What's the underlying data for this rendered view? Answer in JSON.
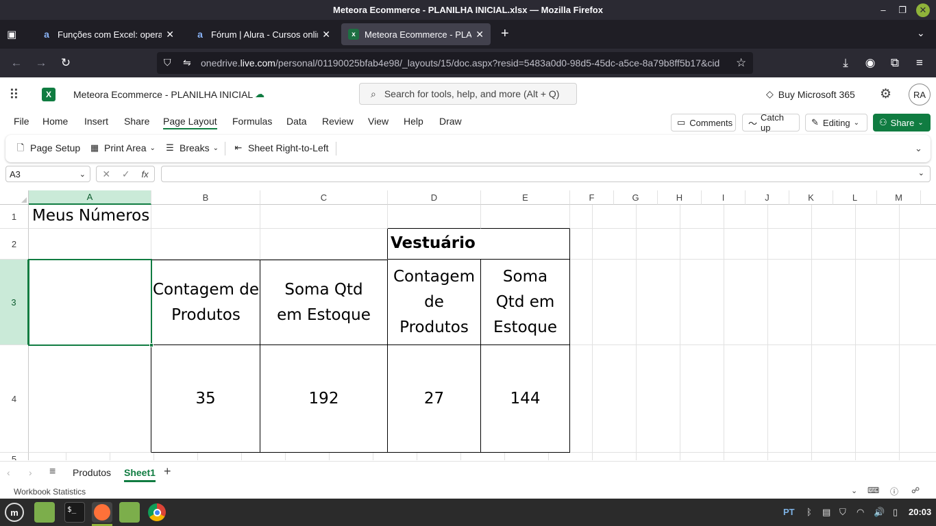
{
  "window": {
    "title": "Meteora Ecommerce - PLANILHA INICIAL.xlsx — Mozilla Firefox"
  },
  "tabs": [
    {
      "title": "Funções com Excel: operaçõ",
      "favicon": "a"
    },
    {
      "title": "Fórum | Alura - Cursos onlin",
      "favicon": "a"
    },
    {
      "title": "Meteora Ecommerce - PLAN",
      "favicon": "excel"
    }
  ],
  "url": {
    "prefix": "onedrive.",
    "domain": "live.com",
    "path": "/personal/01190025bfab4e98/_layouts/15/doc.aspx?resid=5483a0d0-98d5-45dc-a5ce-8a79b8ff5b17&cid"
  },
  "office": {
    "doc_title": "Meteora Ecommerce - PLANILHA INICIAL",
    "search_placeholder": "Search for tools, help, and more (Alt + Q)",
    "buy_label": "Buy Microsoft 365",
    "avatar": "RA"
  },
  "menu": [
    "File",
    "Home",
    "Insert",
    "Share",
    "Page Layout",
    "Formulas",
    "Data",
    "Review",
    "View",
    "Help",
    "Draw"
  ],
  "menu_right": {
    "comments": "Comments",
    "catchup": "Catch up",
    "editing": "Editing",
    "share": "Share"
  },
  "ribbon": {
    "page_setup": "Page Setup",
    "print_area": "Print Area",
    "breaks": "Breaks",
    "rtl": "Sheet Right-to-Left"
  },
  "formula_bar": {
    "name_box": "A3",
    "fx": "fx",
    "formula": ""
  },
  "columns": [
    "A",
    "B",
    "C",
    "D",
    "E",
    "F",
    "G",
    "H",
    "I",
    "J",
    "K",
    "L",
    "M"
  ],
  "rows": [
    "1",
    "2",
    "3",
    "4",
    "5"
  ],
  "cells": {
    "A1": "Meus Números",
    "D2": "Vestuário",
    "B3": "Contagem de Produtos",
    "C3": "Soma Qtd em Estoque",
    "D3": "Contagem de Produtos",
    "E3": "Soma Qtd em Estoque",
    "B4": "35",
    "C4": "192",
    "D4": "27",
    "E4": "144"
  },
  "sheets": [
    "Produtos",
    "Sheet1"
  ],
  "status": {
    "left": "Workbook Statistics"
  },
  "taskbar": {
    "lang": "PT",
    "time": "20:03"
  },
  "colors": {
    "excel_green": "#107c41",
    "selection_header": "#caead8",
    "firefox_dark": "#2b2a33"
  }
}
